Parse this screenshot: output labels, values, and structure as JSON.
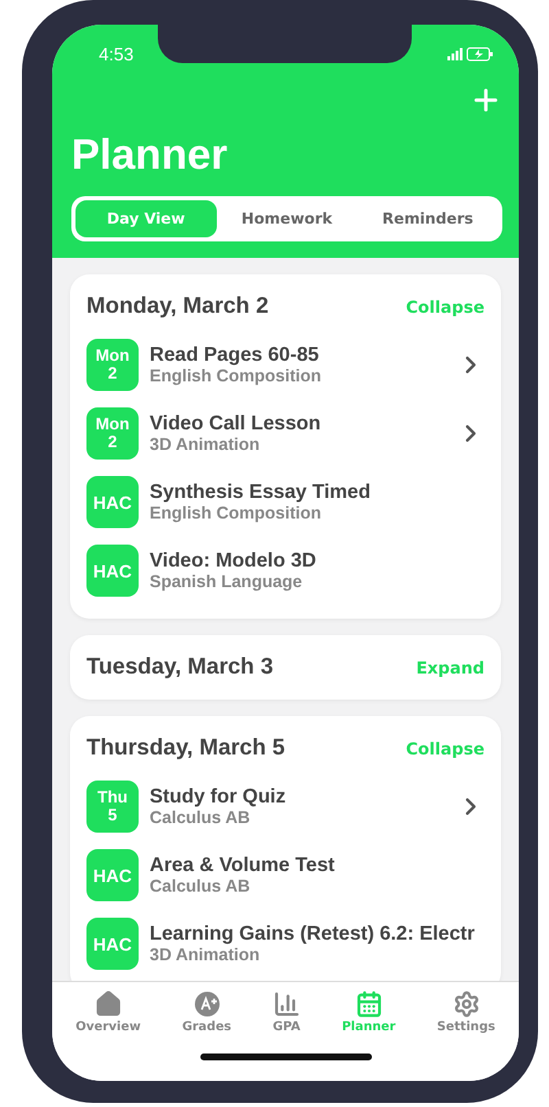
{
  "status_bar": {
    "time": "4:53"
  },
  "header": {
    "title": "Planner"
  },
  "tabs": [
    {
      "label": "Day View",
      "selected": true
    },
    {
      "label": "Homework",
      "selected": false
    },
    {
      "label": "Reminders",
      "selected": false
    }
  ],
  "days": [
    {
      "title": "Monday, March 2",
      "toggle": "Collapse",
      "expanded": true,
      "items": [
        {
          "kind": "date",
          "badge": [
            "Mon",
            "2"
          ],
          "title": "Read Pages 60-85",
          "subtitle": "English Composition",
          "chevron": true
        },
        {
          "kind": "date",
          "badge": [
            "Mon",
            "2"
          ],
          "title": "Video Call Lesson",
          "subtitle": "3D Animation",
          "chevron": true
        },
        {
          "kind": "source",
          "badge": [
            "HAC"
          ],
          "title": "Synthesis Essay Timed",
          "subtitle": "English Composition",
          "chevron": false
        },
        {
          "kind": "source",
          "badge": [
            "HAC"
          ],
          "title": "Video: Modelo 3D",
          "subtitle": "Spanish Language",
          "chevron": false
        }
      ]
    },
    {
      "title": "Tuesday, March 3",
      "toggle": "Expand",
      "expanded": false
    },
    {
      "title": "Thursday, March 5",
      "toggle": "Collapse",
      "expanded": true,
      "items": [
        {
          "kind": "date",
          "badge": [
            "Thu",
            "5"
          ],
          "title": "Study for Quiz",
          "subtitle": "Calculus AB",
          "chevron": true
        },
        {
          "kind": "source",
          "badge": [
            "HAC"
          ],
          "title": "Area & Volume Test",
          "subtitle": "Calculus AB",
          "chevron": false
        },
        {
          "kind": "source",
          "badge": [
            "HAC"
          ],
          "title": "Learning Gains (Retest) 6.2: Electr",
          "subtitle": "3D Animation",
          "chevron": false
        }
      ]
    }
  ],
  "nav": [
    {
      "kind": "home",
      "label": "Overview",
      "selected": false
    },
    {
      "kind": "grades",
      "label": "Grades",
      "selected": false
    },
    {
      "kind": "gpa",
      "label": "GPA",
      "selected": false
    },
    {
      "kind": "planner",
      "label": "Planner",
      "selected": true
    },
    {
      "kind": "settings",
      "label": "Settings",
      "selected": false
    }
  ]
}
